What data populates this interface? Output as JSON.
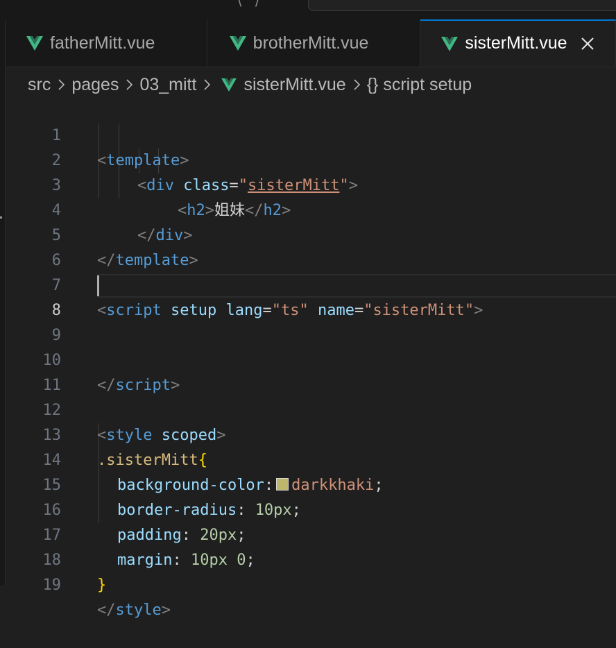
{
  "top": {
    "paren_text": "⟨  ⟩"
  },
  "tabs": [
    {
      "label": "fatherMitt.vue",
      "active": false
    },
    {
      "label": "brotherMitt.vue",
      "active": false
    },
    {
      "label": "sisterMitt.vue",
      "active": true
    }
  ],
  "breadcrumb": {
    "src": "src",
    "pages": "pages",
    "folder": "03_mitt",
    "file": "sisterMitt.vue",
    "symbol": "{} script setup"
  },
  "editor": {
    "current_line": 8,
    "lines": [
      {
        "n": "1"
      },
      {
        "n": "2"
      },
      {
        "n": "3"
      },
      {
        "n": "4"
      },
      {
        "n": "5"
      },
      {
        "n": "6"
      },
      {
        "n": "7"
      },
      {
        "n": "8"
      },
      {
        "n": "9"
      },
      {
        "n": "10"
      },
      {
        "n": "11"
      },
      {
        "n": "12"
      },
      {
        "n": "13"
      },
      {
        "n": "14"
      },
      {
        "n": "15"
      },
      {
        "n": "16"
      },
      {
        "n": "17"
      },
      {
        "n": "18"
      },
      {
        "n": "19"
      }
    ],
    "tokens": {
      "template": "template",
      "div": "div",
      "class_attr": "class",
      "class_val": "sisterMitt",
      "h2": "h2",
      "h2_text": "姐妹",
      "script": "script",
      "setup": "setup",
      "lang_attr": "lang",
      "lang_val": "ts",
      "name_attr": "name",
      "name_val": "sisterMitt",
      "style": "style",
      "scoped": "scoped",
      "selector": ".sisterMitt",
      "prop_bg": "background-color",
      "val_bg": "darkkhaki",
      "prop_radius": "border-radius",
      "val_radius": "10px",
      "prop_padding": "padding",
      "val_padding": "20px",
      "prop_margin": "margin",
      "val_margin_1": "10px",
      "val_margin_2": "0"
    }
  },
  "colors": {
    "editor_bg": "#1f1f1f",
    "active_tab_accent": "#0078d4",
    "darkkhaki_swatch": "#bdb76b"
  }
}
